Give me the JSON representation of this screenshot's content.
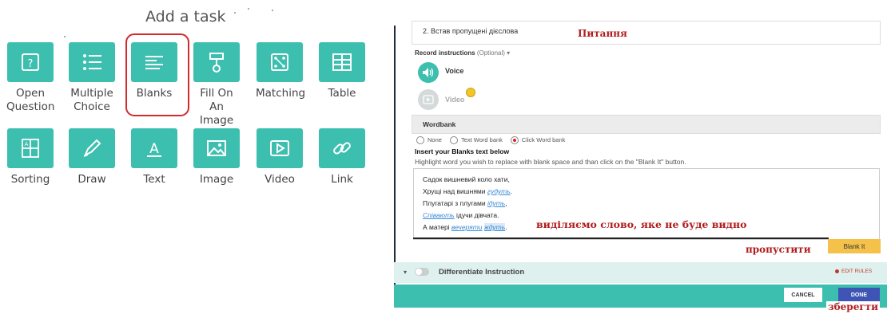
{
  "task_palette": {
    "title": "Add a task",
    "tiles": [
      {
        "label": "Open\nQuestion",
        "icon": "open-question-icon"
      },
      {
        "label": "Multiple\nChoice",
        "icon": "multiple-choice-icon"
      },
      {
        "label": "Blanks",
        "icon": "blanks-icon"
      },
      {
        "label": "Fill On An\nImage",
        "icon": "fill-on-image-icon"
      },
      {
        "label": "Matching",
        "icon": "matching-icon"
      },
      {
        "label": "Table",
        "icon": "table-icon"
      },
      {
        "label": "Sorting",
        "icon": "sorting-icon"
      },
      {
        "label": "Draw",
        "icon": "draw-icon"
      },
      {
        "label": "Text",
        "icon": "text-icon"
      },
      {
        "label": "Image",
        "icon": "image-icon"
      },
      {
        "label": "Video",
        "icon": "video-icon"
      },
      {
        "label": "Link",
        "icon": "link-icon"
      }
    ],
    "tile_color": "#3dbfb0",
    "highlight_color": "#d12b2b"
  },
  "editor": {
    "question": "2. Встав пропущені дієслова",
    "record_instructions": "Record instructions",
    "record_optional": "(Optional) ▾",
    "voice_label": "Voice",
    "video_label": "Video",
    "wordbank_label": "Wordbank",
    "wordbank_options": [
      "None",
      "Text Word bank",
      "Click Word bank"
    ],
    "insert_label": "Insert your Blanks text below",
    "highlight_help": "Highlight word you wish to replace with blank space and than click on the \"Blank It\" button.",
    "lines": {
      "l1": "Садок вишневий коло хати,",
      "l2a": "Хрущі над вишнями ",
      "l2b": "гудуть",
      "l2c": ".",
      "l3a": "Плугатарі з плугами ",
      "l3b": "ідуть",
      "l3c": ",",
      "l4a": "Співають",
      "l4b": " ідучи дівчата.",
      "l5a": "А матері ",
      "l5b": "вечеряти",
      "l5c": " ",
      "l5d": "ждуть",
      "l5e": "."
    },
    "blank_it_button": "Blank It",
    "differentiate_label": "Differentiate Instruction",
    "edit_rules": "EDIT RULES",
    "cancel_button": "CANCEL",
    "done_button": "DONE"
  },
  "annotations": {
    "question_note": "Питання",
    "select_word_note": "виділяємо слово, яке не буде видно",
    "skip_note": "пропустити",
    "save_note": "зберегти"
  },
  "colors": {
    "teal": "#3dbfb0",
    "annotation_red": "#b01c1c",
    "blank_it_yellow": "#f4c24a",
    "done_blue": "#3f55b5"
  }
}
